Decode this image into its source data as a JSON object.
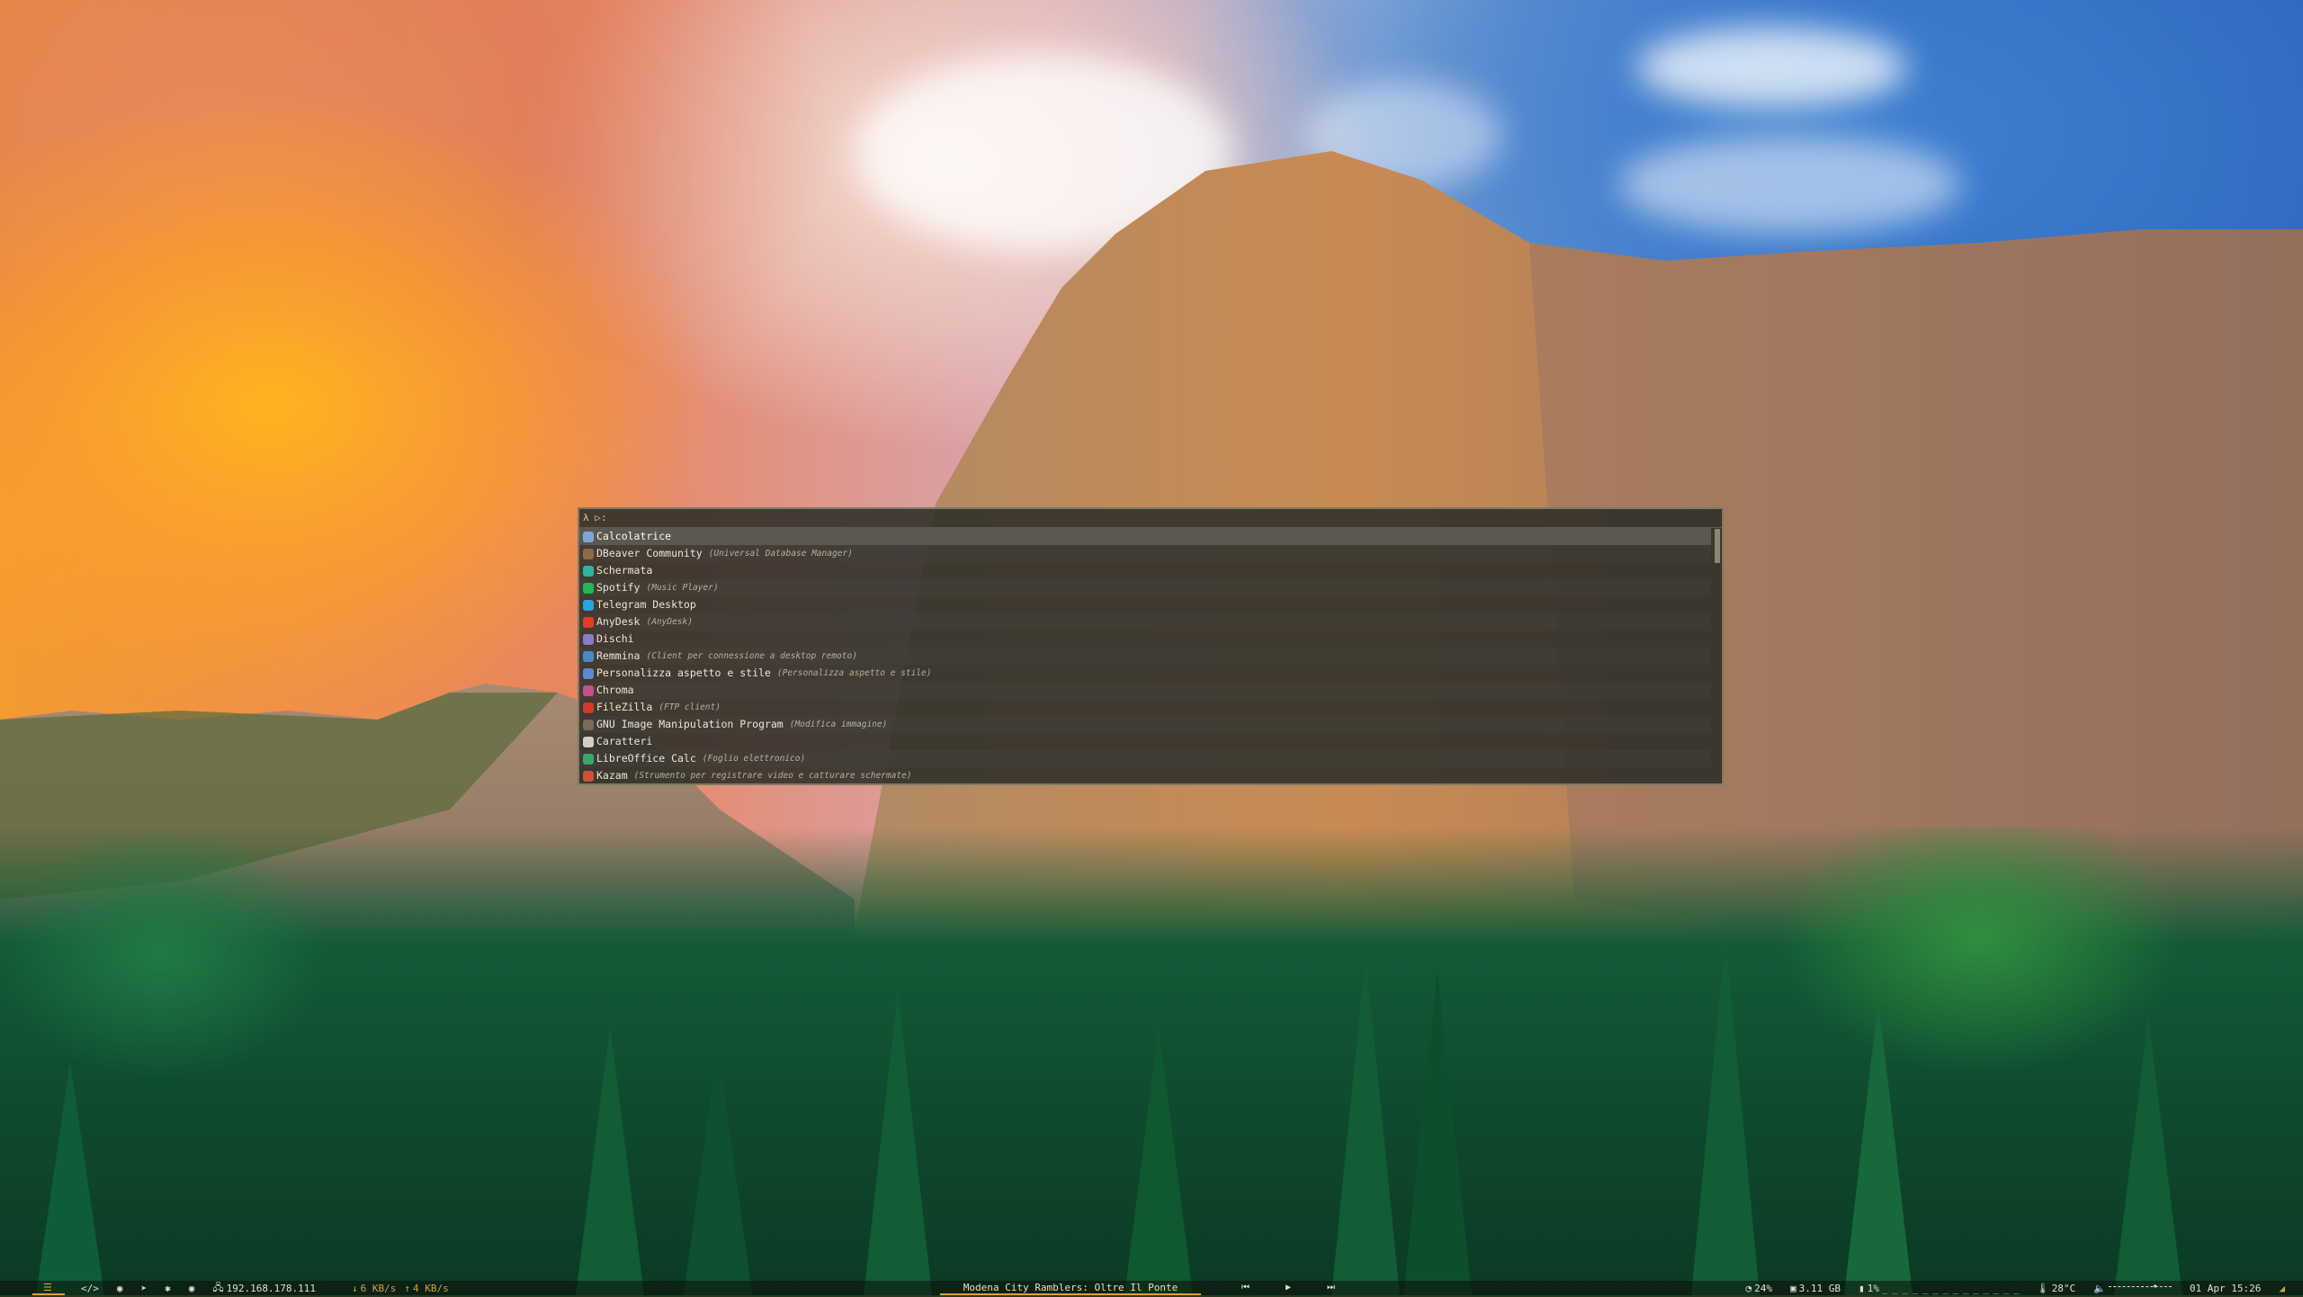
{
  "launcher": {
    "prompt_glyph": "λ ▷:",
    "query": "",
    "items": [
      {
        "label": "Calcolatrice",
        "desc": "",
        "icon": "calculator-icon",
        "color": "#7fa7d6",
        "selected": true
      },
      {
        "label": "DBeaver Community",
        "desc": "(Universal Database Manager)",
        "icon": "dbeaver-icon",
        "color": "#8a6b4a"
      },
      {
        "label": "Schermata",
        "desc": "",
        "icon": "screenshot-icon",
        "color": "#2fb3a3"
      },
      {
        "label": "Spotify",
        "desc": "(Music Player)",
        "icon": "spotify-icon",
        "color": "#1db954"
      },
      {
        "label": "Telegram Desktop",
        "desc": "",
        "icon": "telegram-icon",
        "color": "#2aa3e0"
      },
      {
        "label": "AnyDesk",
        "desc": "(AnyDesk)",
        "icon": "anydesk-icon",
        "color": "#e23d28"
      },
      {
        "label": "Dischi",
        "desc": "",
        "icon": "disks-icon",
        "color": "#8a7ac8"
      },
      {
        "label": "Remmina",
        "desc": "(Client per connessione a desktop remoto)",
        "icon": "remmina-icon",
        "color": "#4a8ac4"
      },
      {
        "label": "Personalizza aspetto e stile",
        "desc": "(Personalizza aspetto e stile)",
        "icon": "appearance-icon",
        "color": "#5a8ad0"
      },
      {
        "label": "Chroma",
        "desc": "",
        "icon": "chroma-icon",
        "color": "#c4508a"
      },
      {
        "label": "FileZilla",
        "desc": "(FTP client)",
        "icon": "filezilla-icon",
        "color": "#d23a2a"
      },
      {
        "label": "GNU Image Manipulation Program",
        "desc": "(Modifica immagine)",
        "icon": "gimp-icon",
        "color": "#7a6a58"
      },
      {
        "label": "Caratteri",
        "desc": "",
        "icon": "fonts-icon",
        "color": "#d0cfc8"
      },
      {
        "label": "LibreOffice Calc",
        "desc": "(Foglio elettronico)",
        "icon": "libreoffice-calc-icon",
        "color": "#3aa86a"
      },
      {
        "label": "Kazam",
        "desc": "(Strumento per registrare video e catturare schermate)",
        "icon": "kazam-icon",
        "color": "#d0503a"
      }
    ]
  },
  "statusbar": {
    "workspace_glyph": "☰",
    "tray": [
      "</>",
      "◉",
      "➤",
      "✱",
      "◉"
    ],
    "ip": "192.168.178.111",
    "net_down": "6 KB/s",
    "net_up": "4 KB/s",
    "now_playing": "Modena City Ramblers: Oltre Il Ponte",
    "media": {
      "prev": "⏮",
      "play": "▶",
      "next": "⏭"
    },
    "cpu": "24%",
    "memory": "3.11 GB",
    "disk": "1%",
    "temperature": "28°C",
    "volume_level": 0.7,
    "datetime": "01 Apr 15:26",
    "accent_color": "#d6a23a"
  }
}
